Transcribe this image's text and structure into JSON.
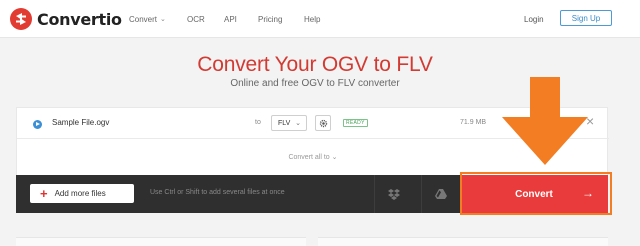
{
  "header": {
    "brand": "Convertio",
    "nav": {
      "convert": "Convert",
      "ocr": "OCR",
      "api": "API",
      "pricing": "Pricing",
      "help": "Help"
    },
    "login": "Login",
    "signup": "Sign Up"
  },
  "hero": {
    "title": "Convert Your OGV to FLV",
    "subtitle": "Online and free OGV to FLV converter"
  },
  "file": {
    "name": "Sample File.ogv",
    "to_label": "to",
    "format": "FLV",
    "status": "READY",
    "size": "71.9 MB"
  },
  "convert_all": "Convert all to",
  "actions": {
    "add_files": "Add more files",
    "hint": "Use Ctrl or Shift to add several files at once",
    "convert": "Convert"
  },
  "colors": {
    "brand_red": "#d23a32",
    "convert_red": "#e93b3b",
    "highlight_orange": "#f37d23",
    "ready_green": "#4aa35b",
    "signup_blue": "#3a8cc8"
  },
  "icons": [
    "logo-icon",
    "caret-down-icon",
    "play-icon",
    "chevron-down-icon",
    "gear-icon",
    "close-icon",
    "plus-icon",
    "dropbox-icon",
    "google-drive-icon",
    "arrow-right-icon",
    "arrow-down-icon"
  ]
}
